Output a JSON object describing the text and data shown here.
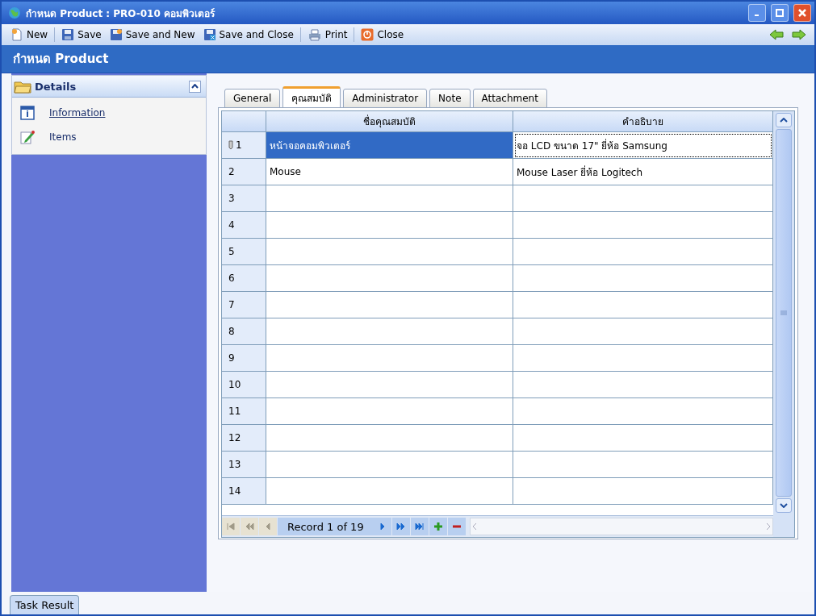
{
  "window": {
    "title": "กำหนด Product : PRO-010 คอมพิวเตอร์"
  },
  "toolbar": [
    {
      "label": "New"
    },
    {
      "label": "Save"
    },
    {
      "label": "Save and New"
    },
    {
      "label": "Save and Close"
    },
    {
      "label": "Print"
    },
    {
      "label": "Close"
    }
  ],
  "header": {
    "title": "กำหนด Product"
  },
  "sidebar": {
    "title": "Details",
    "expanded": true,
    "items": [
      {
        "label": "Information",
        "selected": true
      },
      {
        "label": "Items",
        "selected": false
      }
    ]
  },
  "tabs": [
    {
      "label": "General",
      "selected": false
    },
    {
      "label": "คุณสมบัติ",
      "selected": true
    },
    {
      "label": "Administrator",
      "selected": false
    },
    {
      "label": "Note",
      "selected": false
    },
    {
      "label": "Attachment",
      "selected": false
    }
  ],
  "table": {
    "columns": [
      "ชื่อคุณสมบัติ",
      "คำอธิบาย"
    ],
    "rows": [
      {
        "number": "1",
        "name": "หน้าจอคอมพิวเตอร์",
        "description": "จอ LCD ขนาด 17\" ยี่ห้อ Samsung",
        "selected": true
      },
      {
        "number": "2",
        "name": "Mouse",
        "description": "Mouse Laser ยี่ห้อ Logitech",
        "selected": false
      },
      {
        "number": "3",
        "selected": false
      },
      {
        "number": "4",
        "selected": false
      },
      {
        "number": "5",
        "selected": false
      },
      {
        "number": "6",
        "selected": false
      },
      {
        "number": "7",
        "selected": false
      },
      {
        "number": "8",
        "selected": false
      },
      {
        "number": "9",
        "selected": false
      },
      {
        "number": "10",
        "selected": false
      },
      {
        "number": "11",
        "selected": false
      },
      {
        "number": "12",
        "selected": false
      },
      {
        "number": "13",
        "selected": false
      },
      {
        "number": "14",
        "selected": false
      }
    ],
    "navigator": {
      "record": "Record 1 of 19"
    }
  },
  "bottom_tabs": [
    {
      "label": "Task Result",
      "selected": true
    }
  ]
}
